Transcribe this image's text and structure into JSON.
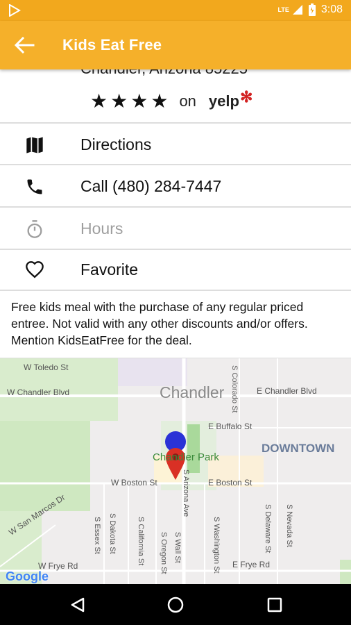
{
  "status_bar": {
    "time": "3:08",
    "network": "LTE"
  },
  "app_bar": {
    "title": "Kids Eat Free"
  },
  "restaurant": {
    "address": "Chandler, Arizona 85225",
    "rating": 4,
    "rating_on": "on",
    "rating_source": "yelp"
  },
  "actions": [
    {
      "label": "Directions",
      "icon": "map-icon"
    },
    {
      "label": "Call (480) 284-7447",
      "icon": "phone-icon"
    },
    {
      "label": "Hours",
      "icon": "timer-icon"
    },
    {
      "label": "Favorite",
      "icon": "heart-icon"
    }
  ],
  "description": "Free kids meal with the purchase of any regular priced entree. Not valid with any other discounts and/or offers. Mention KidsEatFree for the deal.",
  "map": {
    "city": "Chandler",
    "district": "DOWNTOWN",
    "park": "Chandler Park",
    "streets": [
      "W Toledo St",
      "W Chandler Blvd",
      "E Chandler Blvd",
      "E Buffalo St",
      "W Boston St",
      "E Boston St",
      "W San Marcos Dr",
      "W Frye Rd",
      "E Frye Rd",
      "S Colorado St",
      "S Arizona Ave",
      "S Dakota St",
      "S Essex St",
      "S California St",
      "S Oregon St",
      "S Wall St",
      "S Washington St",
      "S Delaware St",
      "S Nevada St"
    ],
    "attribution": "Google"
  },
  "colors": {
    "status_bar": "#f2a81d",
    "app_bar": "#f5b02a",
    "pin": "#d93025",
    "location_dot": "#2a33d6"
  }
}
